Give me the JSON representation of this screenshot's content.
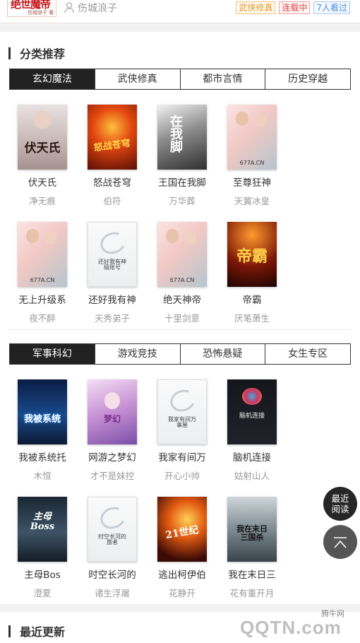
{
  "header": {
    "cover_title": "绝世魔帝",
    "cover_subtitle": "伤城浪子 著",
    "author": "伤城浪子",
    "tags": {
      "category": "武侠修真",
      "status": "连载中",
      "views": "7人看过"
    }
  },
  "category_section": {
    "title": "分类推荐",
    "tabs_a": [
      "玄幻魔法",
      "武侠修真",
      "都市言情",
      "历史穿越"
    ],
    "books_a": [
      {
        "title": "伏天氏",
        "author": "净无痕",
        "cover_text": "伏天氏"
      },
      {
        "title": "怒战苍穹",
        "author": "伯符",
        "cover_text": "怒战苍穹"
      },
      {
        "title": "王国在我脚",
        "author": "万华葬",
        "cover_text": "在我脚"
      },
      {
        "title": "至尊狂神",
        "author": "天翼冰皇",
        "cover_text": "677A.CN"
      },
      {
        "title": "无上升级系",
        "author": "夜不醉",
        "cover_text": "677A.CN"
      },
      {
        "title": "还好我有神",
        "author": "天秀弟子",
        "cover_text": "还好我有神级账号"
      },
      {
        "title": "绝天神帝",
        "author": "十里剑意",
        "cover_text": "677A.CN"
      },
      {
        "title": "帝霸",
        "author": "厌笔萧生",
        "cover_text": "帝霸"
      }
    ],
    "tabs_b": [
      "军事科幻",
      "游戏竞技",
      "恐怖悬疑",
      "女生专区"
    ],
    "books_b": [
      {
        "title": "我被系统托",
        "author": "木恒",
        "cover_text": "我被系统"
      },
      {
        "title": "网游之梦幻",
        "author": "才不是妹控",
        "cover_text": "梦幻"
      },
      {
        "title": "我家有间万",
        "author": "开心小帅",
        "cover_text": "我家有间万事屋"
      },
      {
        "title": "脑机连接",
        "author": "姑射山人",
        "cover_text": "脑机连接"
      },
      {
        "title": "主母Bos",
        "author": "澄夏",
        "cover_text": "主母Boss"
      },
      {
        "title": "时空长河的",
        "author": "诸生浮屠",
        "cover_text": "时空长河的旅者"
      },
      {
        "title": "逃出柯伊伯",
        "author": "花静开",
        "cover_text": "21世纪"
      },
      {
        "title": "我在末日三",
        "author": "花有重开月",
        "cover_text": "我在末日三国杀"
      }
    ]
  },
  "recent_section": {
    "title": "最近更新"
  },
  "floating": {
    "recent_read": "最近阅读"
  },
  "watermark": {
    "small": "腾牛网",
    "big": "QQTN.com"
  },
  "colors": {
    "active_tab": "#222222",
    "tag_category": "#e09a2c",
    "tag_status": "#e04646",
    "tag_views": "#4a8fe0"
  }
}
